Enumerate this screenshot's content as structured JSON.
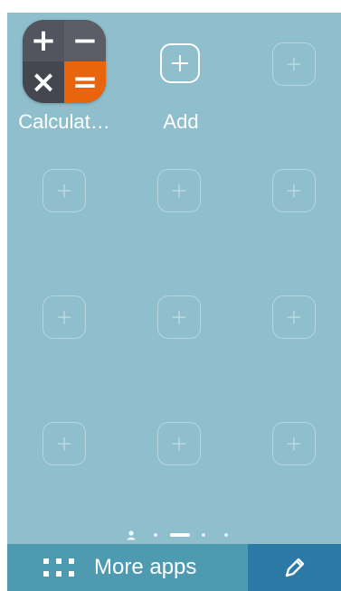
{
  "home_screen": {
    "apps": [
      {
        "label": "Calculat…",
        "icon": "calculator-icon"
      }
    ],
    "add_label": "Add",
    "add_icon": "plus-icon",
    "calculator_symbols": [
      "+",
      "−",
      "×",
      "="
    ]
  },
  "page_indicator": {
    "pages": 5,
    "current_page": 3,
    "first_page_icon": "person-icon"
  },
  "bottom_bar": {
    "more_apps_label": "More apps",
    "more_apps_icon": "grid-icon",
    "edit_icon": "pencil-icon"
  },
  "colors": {
    "background": "#8fbfcc",
    "more_apps_bg": "#4e9bb1",
    "edit_bg": "#2c79a6",
    "calculator_accent": "#e8650d"
  }
}
